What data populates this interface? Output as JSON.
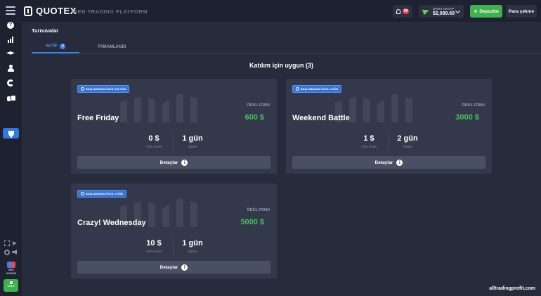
{
  "header": {
    "logo": "QUOTEX",
    "platform": "WEB TRADING PLATFORM",
    "notifications_badge": "99",
    "account_label": "DEMO HESAP",
    "balance": "$2,089.69",
    "deposit_label": "Depozito",
    "withdraw_label": "Para çekme"
  },
  "sidebar": {
    "icons": [
      "help-icon",
      "chart-icon",
      "education-icon",
      "profile-icon",
      "analytics-icon",
      "coins-icon",
      "tournament-icon"
    ],
    "badge_text_1": "BES",
    "badge_text_2": "KATILIM",
    "online_label": "Yardım"
  },
  "page": {
    "title": "Turnuvalar",
    "tabs": [
      {
        "label": "AKTİF",
        "count": "3"
      },
      {
        "label": "TAMAMLANDI"
      }
    ],
    "available_title": "Katılım için uygun (3)"
  },
  "cards": [
    {
      "badge": "BAŞLAMADAN ÖNCE: 000 GÜN",
      "prize_label": "ÖDÜL FONU",
      "name": "Free Friday",
      "prize": "600 $",
      "fee": "0 $",
      "fee_label": "Giriş ücreti",
      "duration": "1 gün",
      "duration_label": "Süresi",
      "details": "Detaylar"
    },
    {
      "badge": "BAŞLAMADAN ÖNCE: 2 GÜN",
      "prize_label": "ÖDÜL FONU",
      "name": "Weekend Battle",
      "prize": "3000 $",
      "fee": "1 $",
      "fee_label": "Giriş ücreti",
      "duration": "2 gün",
      "duration_label": "Süresi",
      "details": "Detaylar"
    },
    {
      "badge": "BAŞLAMADAN ÖNCE: 4 GÜN",
      "prize_label": "ÖDÜL FONU",
      "name": "Crazy! Wednesday",
      "prize": "5000 $",
      "fee": "10 $",
      "fee_label": "Giriş ücreti",
      "duration": "1 gün",
      "duration_label": "Süresi",
      "details": "Detaylar"
    }
  ],
  "site_watermark": "alltradingprofit.com",
  "colors": {
    "accent": "#3b82f0",
    "green": "#44c060",
    "card": "#33394b"
  }
}
